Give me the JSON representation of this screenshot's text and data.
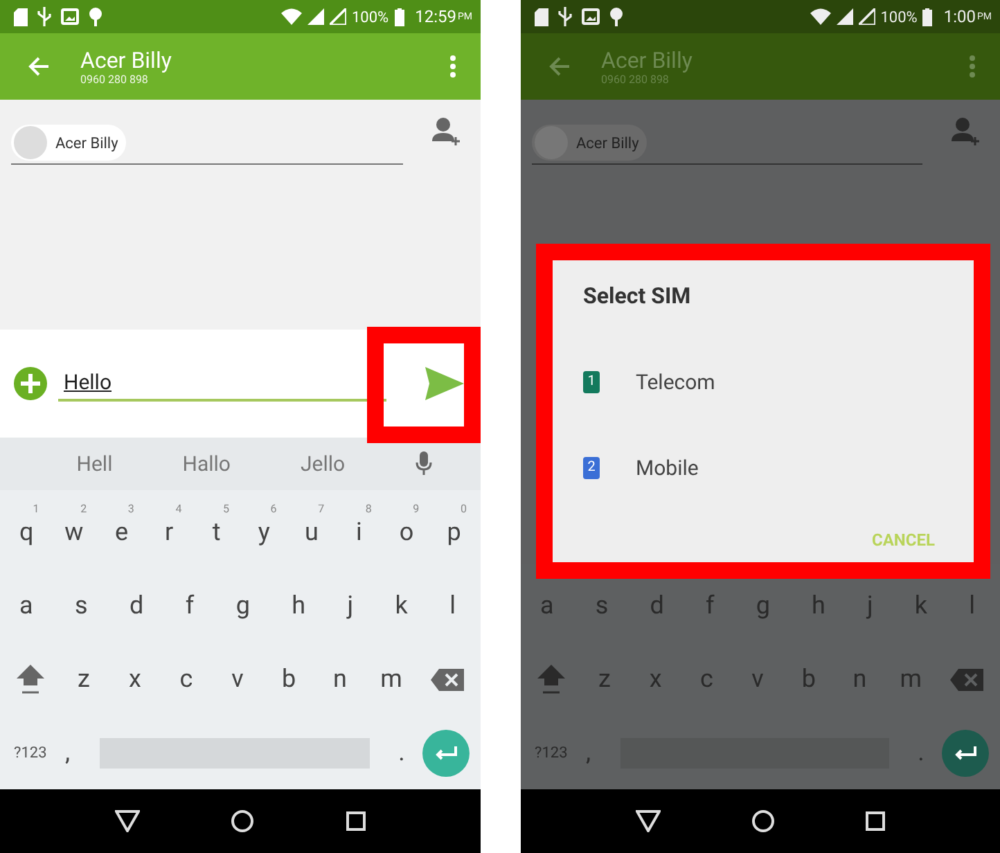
{
  "screens": [
    {
      "dimmed": false,
      "status_bar": {
        "battery": "100%",
        "time": "12:59",
        "ampm": "PM"
      },
      "app_bar": {
        "title": "Acer Billy",
        "subtitle": "0960 280 898"
      },
      "recipient": {
        "name": "Acer Billy"
      },
      "compose": {
        "value": "Hello",
        "send_highlighted": true
      },
      "suggestions": [
        "Hell",
        "Hallo",
        "Jello"
      ],
      "keyboard": [
        [
          {
            "kind": "letter",
            "label": "q",
            "hint": "1"
          },
          {
            "kind": "letter",
            "label": "w",
            "hint": "2"
          },
          {
            "kind": "letter",
            "label": "e",
            "hint": "3"
          },
          {
            "kind": "letter",
            "label": "r",
            "hint": "4"
          },
          {
            "kind": "letter",
            "label": "t",
            "hint": "5"
          },
          {
            "kind": "letter",
            "label": "y",
            "hint": "6"
          },
          {
            "kind": "letter",
            "label": "u",
            "hint": "7"
          },
          {
            "kind": "letter",
            "label": "i",
            "hint": "8"
          },
          {
            "kind": "letter",
            "label": "o",
            "hint": "9"
          },
          {
            "kind": "letter",
            "label": "p",
            "hint": "0"
          }
        ],
        [
          {
            "kind": "letter",
            "label": "a"
          },
          {
            "kind": "letter",
            "label": "s"
          },
          {
            "kind": "letter",
            "label": "d"
          },
          {
            "kind": "letter",
            "label": "f"
          },
          {
            "kind": "letter",
            "label": "g"
          },
          {
            "kind": "letter",
            "label": "h"
          },
          {
            "kind": "letter",
            "label": "j"
          },
          {
            "kind": "letter",
            "label": "k"
          },
          {
            "kind": "letter",
            "label": "l"
          }
        ],
        [
          {
            "kind": "shift"
          },
          {
            "kind": "letter",
            "label": "z"
          },
          {
            "kind": "letter",
            "label": "x"
          },
          {
            "kind": "letter",
            "label": "c"
          },
          {
            "kind": "letter",
            "label": "v"
          },
          {
            "kind": "letter",
            "label": "b"
          },
          {
            "kind": "letter",
            "label": "n"
          },
          {
            "kind": "letter",
            "label": "m"
          },
          {
            "kind": "backspace"
          }
        ],
        [
          {
            "kind": "symbols",
            "label": "?123"
          },
          {
            "kind": "comma",
            "label": ","
          },
          {
            "kind": "space"
          },
          {
            "kind": "period",
            "label": "."
          },
          {
            "kind": "enter"
          }
        ]
      ]
    },
    {
      "dimmed": true,
      "status_bar": {
        "battery": "100%",
        "time": "1:00",
        "ampm": "PM"
      },
      "app_bar": {
        "title": "Acer Billy",
        "subtitle": "0960 280 898"
      },
      "recipient": {
        "name": "Acer Billy"
      },
      "keyboard": [
        [
          {
            "kind": "letter",
            "label": "a"
          },
          {
            "kind": "letter",
            "label": "s"
          },
          {
            "kind": "letter",
            "label": "d"
          },
          {
            "kind": "letter",
            "label": "f"
          },
          {
            "kind": "letter",
            "label": "g"
          },
          {
            "kind": "letter",
            "label": "h"
          },
          {
            "kind": "letter",
            "label": "j"
          },
          {
            "kind": "letter",
            "label": "k"
          },
          {
            "kind": "letter",
            "label": "l"
          }
        ],
        [
          {
            "kind": "shift"
          },
          {
            "kind": "letter",
            "label": "z"
          },
          {
            "kind": "letter",
            "label": "x"
          },
          {
            "kind": "letter",
            "label": "c"
          },
          {
            "kind": "letter",
            "label": "v"
          },
          {
            "kind": "letter",
            "label": "b"
          },
          {
            "kind": "letter",
            "label": "n"
          },
          {
            "kind": "letter",
            "label": "m"
          },
          {
            "kind": "backspace"
          }
        ],
        [
          {
            "kind": "symbols",
            "label": "?123"
          },
          {
            "kind": "comma",
            "label": ","
          },
          {
            "kind": "space"
          },
          {
            "kind": "period",
            "label": "."
          },
          {
            "kind": "enter"
          }
        ]
      ],
      "dialog": {
        "title": "Select SIM",
        "highlighted": true,
        "options": [
          {
            "badge": "1",
            "name": "Telecom",
            "color": "#137a5d"
          },
          {
            "badge": "2",
            "name": "Mobile",
            "color": "#3b6fd6"
          }
        ],
        "button": "CANCEL"
      }
    }
  ]
}
